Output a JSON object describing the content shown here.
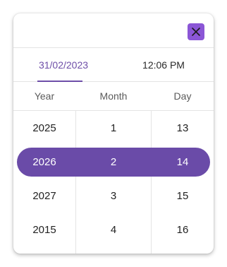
{
  "tabs": {
    "date": "31/02/2023",
    "time": "12:06 PM"
  },
  "headers": {
    "year": "Year",
    "month": "Month",
    "day": "Day"
  },
  "columns": {
    "year": [
      "2025",
      "2026",
      "2027",
      "2015"
    ],
    "month": [
      "1",
      "2",
      "3",
      "4"
    ],
    "day": [
      "13",
      "14",
      "15",
      "16"
    ]
  },
  "colors": {
    "accent": "#6a4ba8",
    "close_button": "#8b56d6"
  }
}
